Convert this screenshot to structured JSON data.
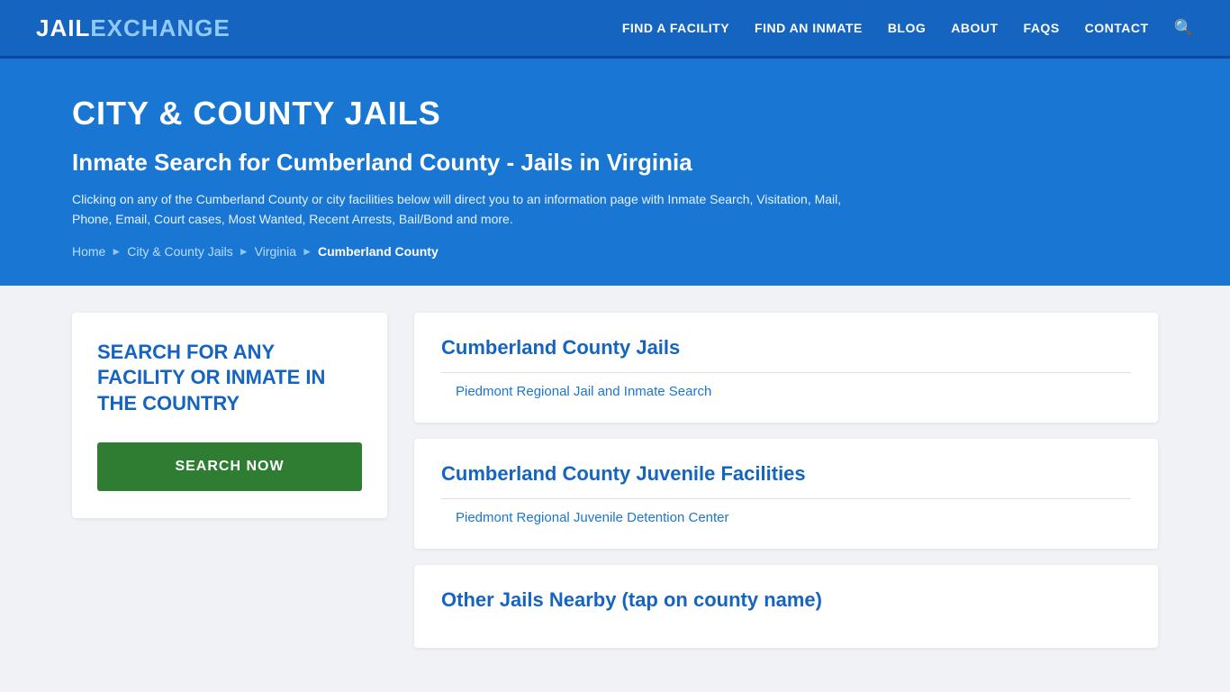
{
  "header": {
    "logo_jail": "JAIL",
    "logo_exchange": "EXCHANGE",
    "nav": {
      "find_facility": "FIND A FACILITY",
      "find_inmate": "FIND AN INMATE",
      "blog": "BLOG",
      "about": "ABOUT",
      "faqs": "FAQs",
      "contact": "CONTACT"
    }
  },
  "hero": {
    "title": "CITY & COUNTY JAILS",
    "subtitle": "Inmate Search for Cumberland County - Jails in Virginia",
    "description": "Clicking on any of the Cumberland County or city facilities below will direct you to an information page with Inmate Search, Visitation, Mail, Phone, Email, Court cases, Most Wanted, Recent Arrests, Bail/Bond and more.",
    "breadcrumb": {
      "home": "Home",
      "city_county": "City & County Jails",
      "state": "Virginia",
      "county": "Cumberland County"
    }
  },
  "left_panel": {
    "prompt": "SEARCH FOR ANY FACILITY OR INMATE IN THE COUNTRY",
    "button": "SEARCH NOW"
  },
  "cards": [
    {
      "title": "Cumberland County Jails",
      "links": [
        "Piedmont Regional Jail and Inmate Search"
      ]
    },
    {
      "title": "Cumberland County Juvenile Facilities",
      "links": [
        "Piedmont Regional Juvenile Detention Center"
      ]
    },
    {
      "title": "Other Jails Nearby (tap on county name)",
      "links": []
    }
  ]
}
